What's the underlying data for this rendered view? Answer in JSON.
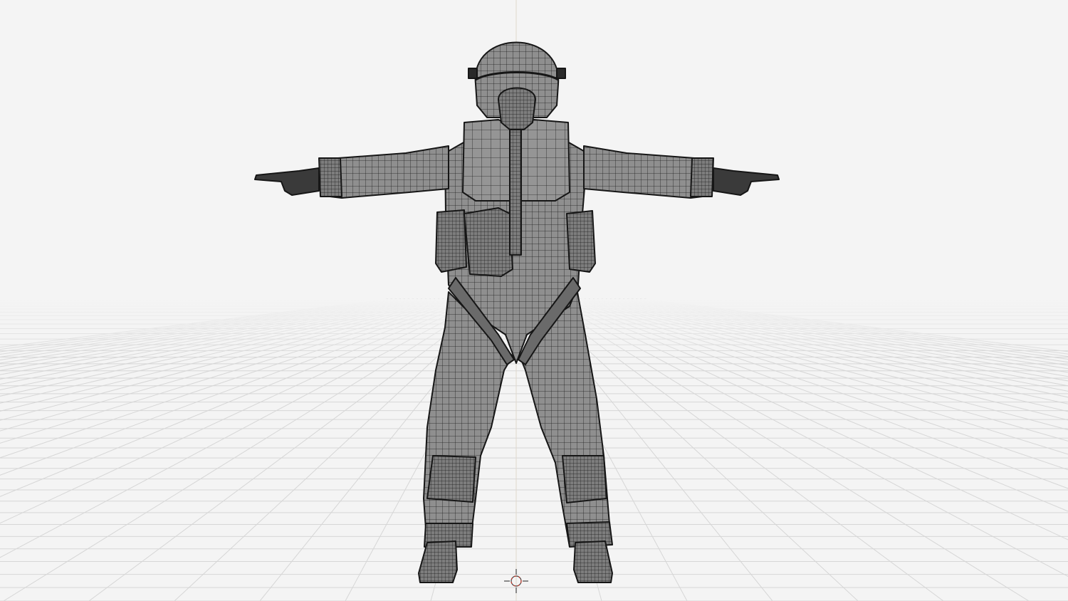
{
  "viewport": {
    "view": "front-orthographic",
    "shading": "wireframe-on-shaded",
    "background_color": "#f4f4f4",
    "grid_color": "#d6d6d6",
    "wire_color": "#1c1c1c",
    "mesh_fill_color": "#8f8f8f",
    "pose": "t-pose"
  },
  "icons": {
    "origin": "3d-cursor-icon"
  }
}
